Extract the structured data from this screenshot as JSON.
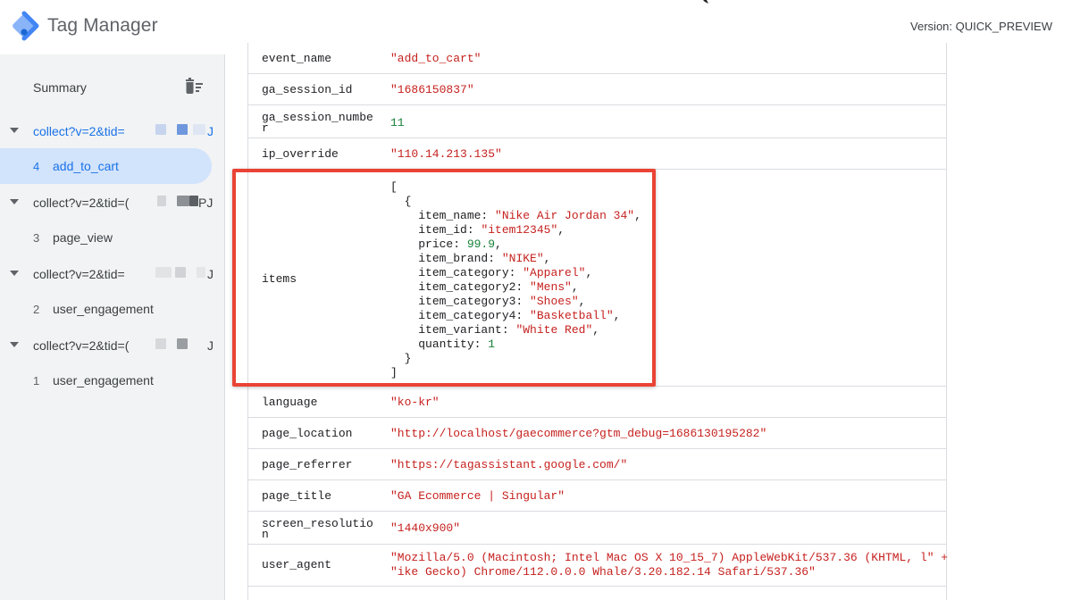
{
  "header": {
    "title": "Tag Manager",
    "version": "Version: QUICK_PREVIEW"
  },
  "sidebar": {
    "summary_label": "Summary",
    "groups": [
      {
        "label": "collect?v=2&tid=",
        "suffix": "J",
        "event_num": "4",
        "event_label": "add_to_cart"
      },
      {
        "label": "collect?v=2&tid=(",
        "suffix": "PJ",
        "event_num": "3",
        "event_label": "page_view"
      },
      {
        "label": "collect?v=2&tid=",
        "suffix": "J",
        "event_num": "2",
        "event_label": "user_engagement"
      },
      {
        "label": "collect?v=2&tid=(",
        "suffix": "J",
        "event_num": "1",
        "event_label": "user_engagement"
      }
    ]
  },
  "table": {
    "rows": [
      {
        "key": "event_name",
        "value": "\"add_to_cart\""
      },
      {
        "key": "ga_session_id",
        "value": "\"1686150837\""
      },
      {
        "key_line1": "ga_session_numbe",
        "key_line2": "r",
        "value": "11"
      },
      {
        "key": "ip_override",
        "value": "\"110.14.213.135\""
      },
      {
        "key": "items"
      },
      {
        "key": "language",
        "value": "\"ko-kr\""
      },
      {
        "key": "page_location",
        "value": "\"http://localhost/gaecommerce?gtm_debug=1686130195282\""
      },
      {
        "key": "page_referrer",
        "value": "\"https://tagassistant.google.com/\""
      },
      {
        "key": "page_title",
        "value": "\"GA Ecommerce | Singular\""
      },
      {
        "key_line1": "screen_resolutio",
        "key_line2": "n",
        "value": "\"1440x900\""
      },
      {
        "key": "user_agent",
        "value_line1": "\"Mozilla/5.0 (Macintosh; Intel Mac OS X 10_15_7) AppleWebKit/537.36 (KHTML, l\" +",
        "value_line2": "\"ike Gecko) Chrome/112.0.0.0 Whale/3.20.182.14 Safari/537.36\""
      }
    ]
  },
  "items_json": {
    "open_bracket": "[",
    "open_brace": "{",
    "item_name_key": "item_name: ",
    "item_name": "\"Nike Air Jordan 34\"",
    "item_id_key": "item_id: ",
    "item_id": "\"item12345\"",
    "price_key": "price: ",
    "price": "99.9",
    "item_brand_key": "item_brand: ",
    "item_brand": "\"NIKE\"",
    "item_category_key": "item_category: ",
    "item_category": "\"Apparel\"",
    "item_category2_key": "item_category2: ",
    "item_category2": "\"Mens\"",
    "item_category3_key": "item_category3: ",
    "item_category3": "\"Shoes\"",
    "item_category4_key": "item_category4: ",
    "item_category4": "\"Basketball\"",
    "item_variant_key": "item_variant: ",
    "item_variant": "\"White Red\"",
    "quantity_key": "quantity: ",
    "quantity": "1",
    "comma": ",",
    "close_brace": "}",
    "close_bracket": "]"
  },
  "colors": {
    "accent": "#1a73e8",
    "string": "#c5221f",
    "number": "#188038",
    "highlight": "#ea4335",
    "selected_bg": "#d2e3fc"
  }
}
